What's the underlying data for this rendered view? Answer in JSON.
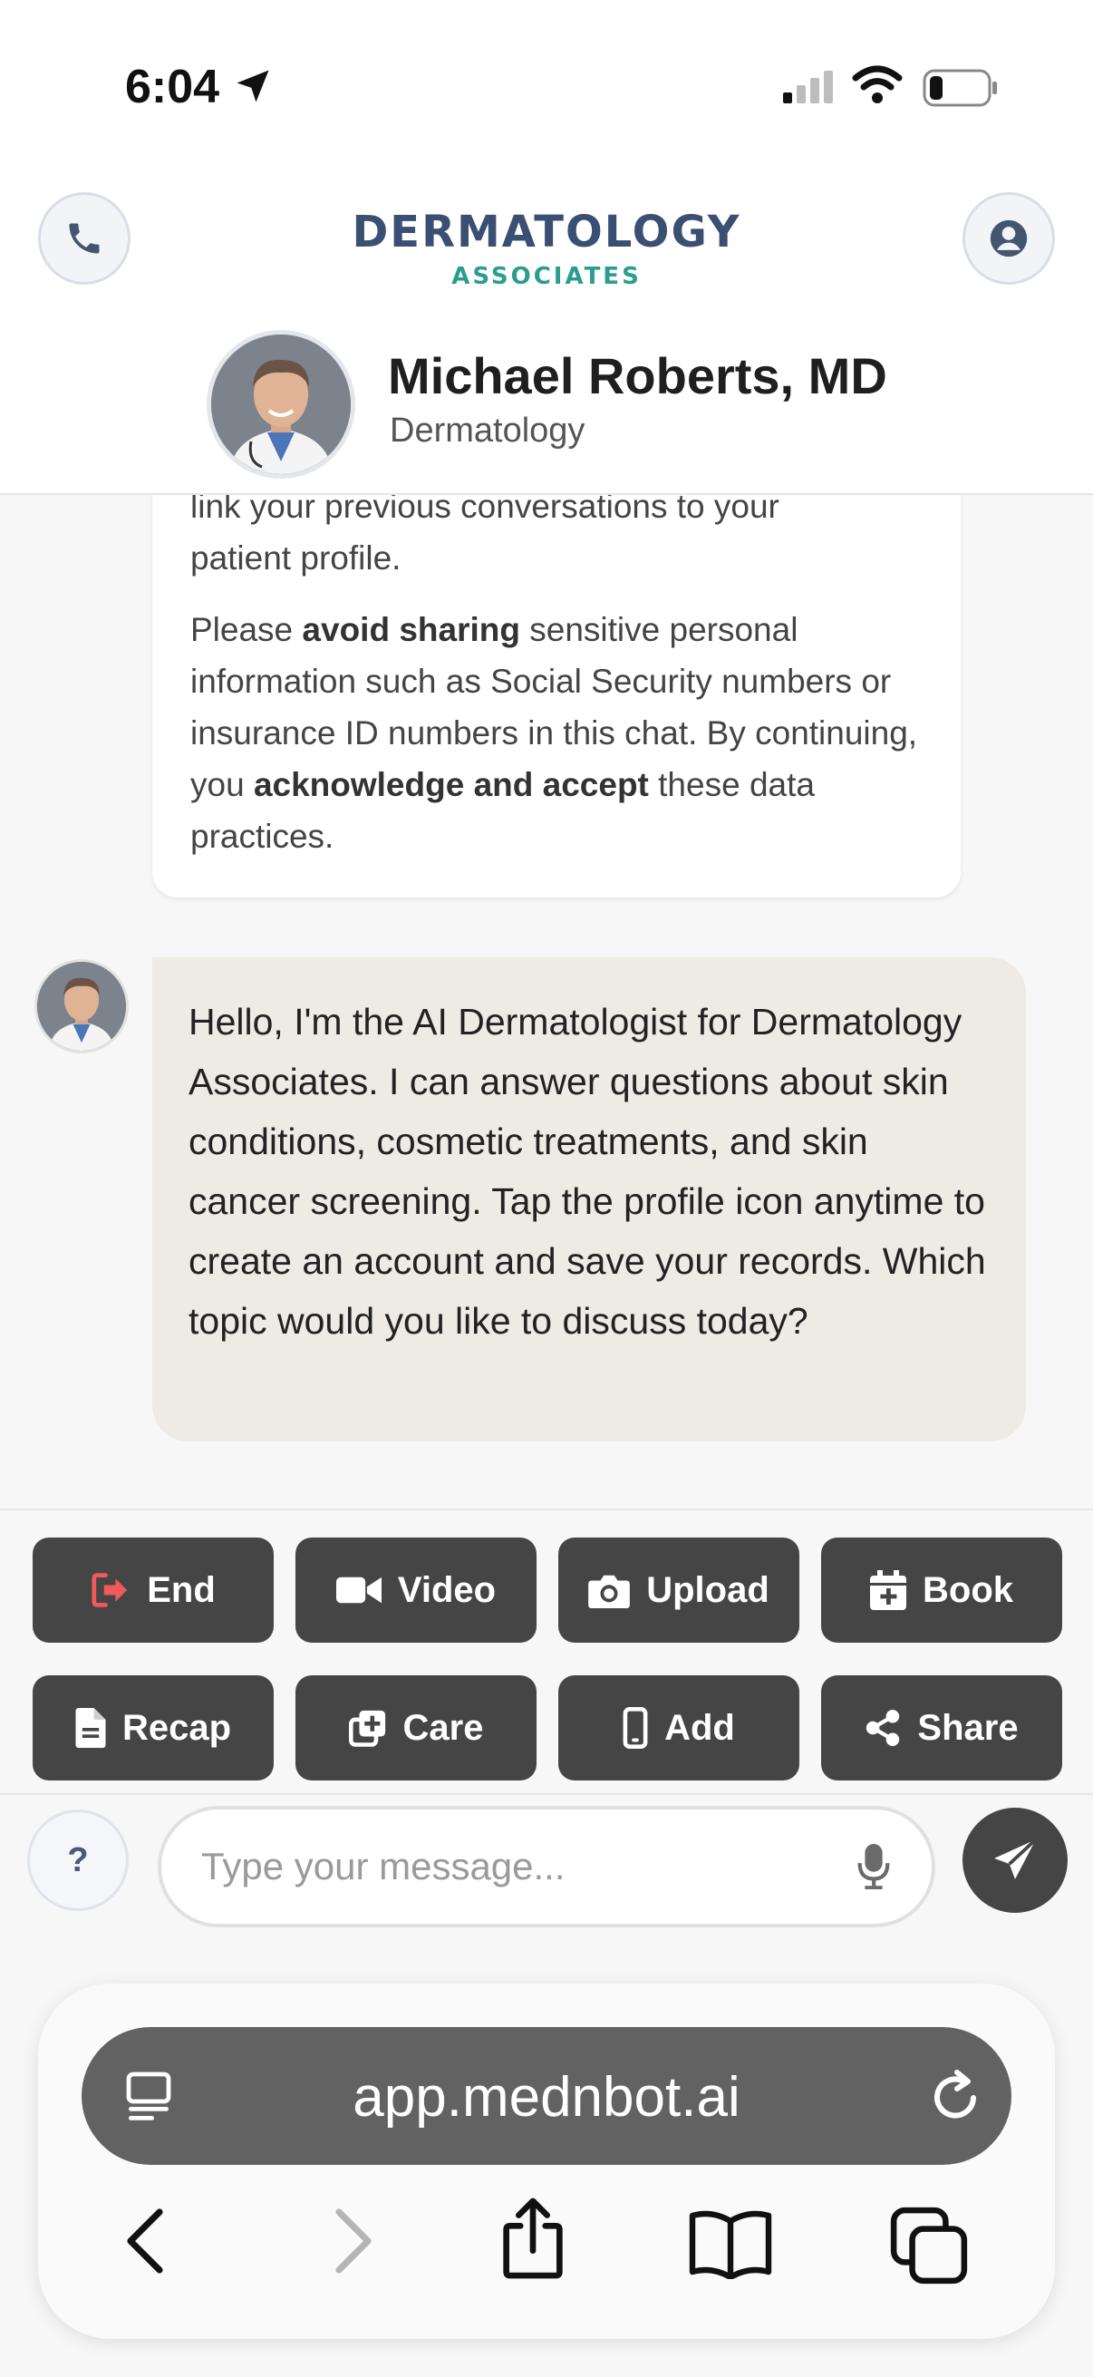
{
  "status_bar": {
    "time": "6:04"
  },
  "header": {
    "logo_main": "DERMATOLOGY",
    "logo_sub": "ASSOCIATES",
    "doctor_name": "Michael Roberts, MD",
    "doctor_specialty": "Dermatology",
    "icons": {
      "left": "phone-icon",
      "right": "profile-icon"
    }
  },
  "chat": {
    "notice_partial_line": "link your previous conversations to your",
    "notice_line2": "patient profile.",
    "notice_p2_a": "Please ",
    "notice_p2_b": "avoid sharing",
    "notice_p2_c": " sensitive personal information such as Social Security numbers or insurance ID numbers in this chat. By continuing, you ",
    "notice_p2_d": "acknowledge and accept",
    "notice_p2_e": " these data practices.",
    "bot_message": "Hello, I'm the AI Dermatologist for Dermatology Associates. I can answer questions about skin conditions, cosmetic treatments, and skin cancer screening. Tap the profile icon anytime to create an account and save your records. Which topic would you like to discuss today?"
  },
  "actions": [
    {
      "label": "End",
      "icon": "exit-icon",
      "icon_color": "#f05a5a"
    },
    {
      "label": "Video",
      "icon": "video-icon",
      "icon_color": "#ffffff"
    },
    {
      "label": "Upload",
      "icon": "camera-icon",
      "icon_color": "#ffffff"
    },
    {
      "label": "Book",
      "icon": "calendar-plus-icon",
      "icon_color": "#ffffff"
    },
    {
      "label": "Recap",
      "icon": "document-icon",
      "icon_color": "#ffffff"
    },
    {
      "label": "Care",
      "icon": "copy-plus-icon",
      "icon_color": "#ffffff"
    },
    {
      "label": "Add",
      "icon": "mobile-icon",
      "icon_color": "#ffffff"
    },
    {
      "label": "Share",
      "icon": "share-icon",
      "icon_color": "#ffffff"
    }
  ],
  "input": {
    "help_label": "?",
    "placeholder": "Type your message...",
    "value": ""
  },
  "browser": {
    "url": "app.mednbot.ai"
  },
  "colors": {
    "brand_navy": "#3b4f73",
    "brand_teal": "#2b9d8f",
    "button_dark": "#454545",
    "bubble_bg": "#eeeae4"
  }
}
